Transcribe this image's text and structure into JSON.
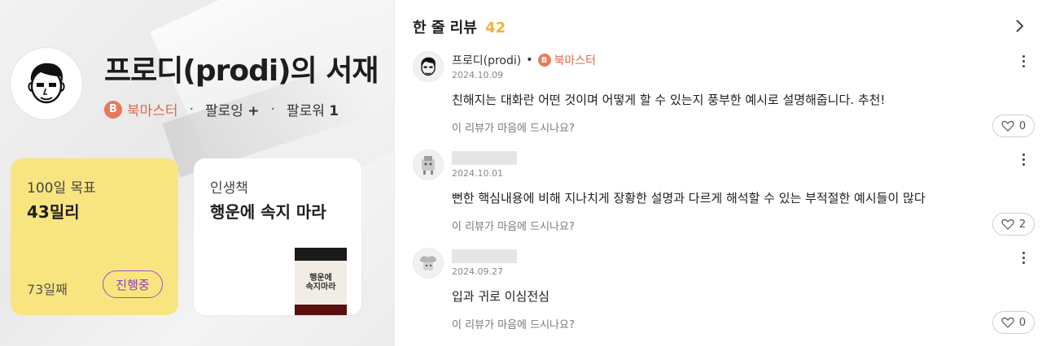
{
  "profile": {
    "name": "프로디(prodi)",
    "shelf_title": "프로디(prodi)의 서재",
    "badge_letter": "B",
    "badge_label": "북마스터",
    "following_label": "팔로잉",
    "following_value": "+",
    "followers_label": "팔로워",
    "followers_value": "1"
  },
  "goal_card": {
    "label": "100일 목표",
    "value": "43밀리",
    "days": "73일째",
    "status_button": "진행중",
    "color": "#f9e57f"
  },
  "life_book_card": {
    "label": "인생책",
    "book_title": "행운에 속지 마라",
    "cover_text": "행운에\n속지마라"
  },
  "reviews_section": {
    "title": "한 줄 리뷰",
    "count": "42",
    "count_color": "#f0b43a",
    "more_icon": "chevron-right-icon"
  },
  "reviews": [
    {
      "author": "프로디(prodi)",
      "separator": "•",
      "badge_letter": "B",
      "badge_label": "북마스터",
      "date": "2024.10.09",
      "text": "친해지는 대화란 어떤 것이며 어떻게 할 수 있는지 풍부한 예시로 설명해줍니다. 추천!",
      "like_prompt": "이 리뷰가 마음에 드시나요?",
      "likes": "0"
    },
    {
      "author": "",
      "date": "2024.10.01",
      "text": "뻔한 핵심내용에 비해 지나치게 장황한 설명과 다르게 해석할 수 있는 부적절한 예시들이 많다",
      "like_prompt": "이 리뷰가 마음에 드시나요?",
      "likes": "2"
    },
    {
      "author": "",
      "date": "2024.09.27",
      "text": "입과 귀로 이심전심",
      "like_prompt": "이 리뷰가 마음에 드시나요?",
      "likes": "0"
    }
  ],
  "colors": {
    "badge": "#e87a5b",
    "badge_text": "#e0684a",
    "status_button": "#8a3ec0"
  }
}
